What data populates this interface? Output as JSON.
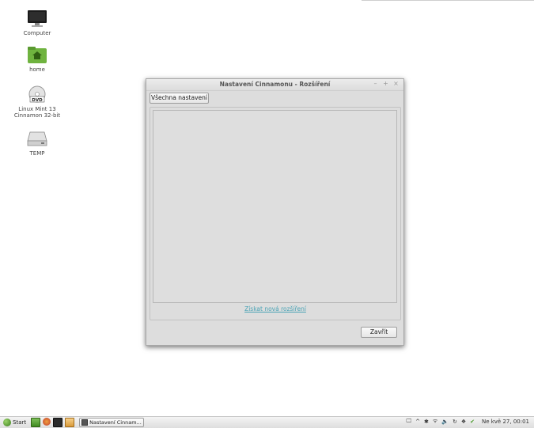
{
  "desktop": {
    "icons": [
      {
        "label": "Computer"
      },
      {
        "label": "home"
      },
      {
        "label": "Linux Mint 13\nCinnamon 32-bit"
      },
      {
        "label": "TEMP"
      }
    ]
  },
  "window": {
    "title": "Nastavení Cinnamonu - Rozšíření",
    "all_settings_label": "Všechna nastavení",
    "link_label": "Získat nová rozšíření",
    "close_label": "Zavřít",
    "controls": [
      "–",
      "+",
      "×"
    ]
  },
  "taskbar": {
    "start_label": "Start",
    "task_label": "Nastavení Cinnam...",
    "clock": "Ne kvě 27, 00:01"
  },
  "colors": {
    "link": "#4aa3b5",
    "start_orb": "#3a7d1c"
  }
}
